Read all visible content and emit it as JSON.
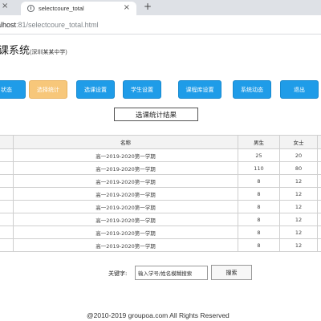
{
  "browser": {
    "tab_title": "selectcoure_total",
    "url_host": "alhost",
    "url_rest": ":81/selectcoure_total.html"
  },
  "page": {
    "title": "课系统",
    "subtitle": "(深圳某某中学)"
  },
  "nav": [
    {
      "label": "状态",
      "active": false
    },
    {
      "label": "选择统计",
      "active": true
    },
    {
      "label": "选课设置",
      "active": false
    },
    {
      "label": "学生设置",
      "active": false
    },
    {
      "label": "课程库设置",
      "active": false
    },
    {
      "label": "系统动态",
      "active": false
    },
    {
      "label": "退出",
      "active": false
    }
  ],
  "result_button": "选课统计结果",
  "table": {
    "headers": [
      "",
      "名称",
      "男生",
      "女士",
      ""
    ],
    "rows": [
      {
        "name": "高一2019-2020第一学期",
        "male": "25",
        "female": "20"
      },
      {
        "name": "高一2019-2020第一学期",
        "male": "110",
        "female": "80"
      },
      {
        "name": "高一2019-2020第一学期",
        "male": "8",
        "female": "12"
      },
      {
        "name": "高一2019-2020第一学期",
        "male": "8",
        "female": "12"
      },
      {
        "name": "高一2019-2020第一学期",
        "male": "8",
        "female": "12"
      },
      {
        "name": "高一2019-2020第一学期",
        "male": "8",
        "female": "12"
      },
      {
        "name": "高一2019-2020第一学期",
        "male": "8",
        "female": "12"
      },
      {
        "name": "高一2019-2020第一学期",
        "male": "8",
        "female": "12"
      }
    ]
  },
  "search": {
    "label": "关键字:",
    "value": "输入学号/姓名模糊搜索",
    "button": "搜索"
  },
  "footer": "@2010-2019 groupoa.com  All Rights Reserved",
  "colors": {
    "nav_blue": "#1f9ce8",
    "nav_active": "#f7c77a"
  }
}
